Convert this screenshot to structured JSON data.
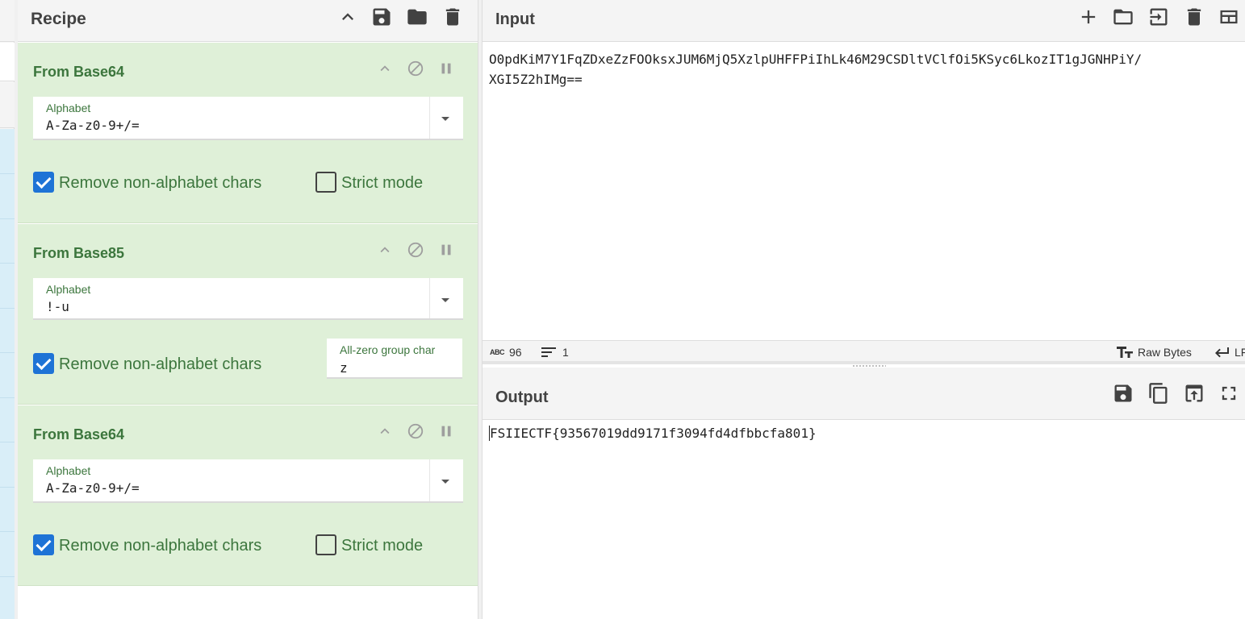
{
  "recipe": {
    "title": "Recipe",
    "operations": [
      {
        "name": "From Base64",
        "alphabet_label": "Alphabet",
        "alphabet_value": "A-Za-z0-9+/=",
        "remove_label": "Remove non-alphabet chars",
        "remove_checked": true,
        "strict_label": "Strict mode",
        "strict_checked": false
      },
      {
        "name": "From Base85",
        "alphabet_label": "Alphabet",
        "alphabet_value": "!-u",
        "remove_label": "Remove non-alphabet chars",
        "remove_checked": true,
        "zero_label": "All-zero group char",
        "zero_value": "z"
      },
      {
        "name": "From Base64",
        "alphabet_label": "Alphabet",
        "alphabet_value": "A-Za-z0-9+/=",
        "remove_label": "Remove non-alphabet chars",
        "remove_checked": true,
        "strict_label": "Strict mode",
        "strict_checked": false
      }
    ]
  },
  "input": {
    "title": "Input",
    "text": "O0pdKiM7Y1FqZDxeZzFOOksxJUM6MjQ5XzlpUHFFPiIhLk46M29CSDltVClfOi5KSyc6LkozIT1gJGNHPiY/XGI5Z2hIMg==",
    "line1": "O0pdKiM7Y1FqZDxeZzFOOksxJUM6MjQ5XzlpUHFFPiIhLk46M29CSDltVClfOi5KSyc6LkozIT1gJGNHPiY/",
    "line2": "XGI5Z2hIMg=="
  },
  "status": {
    "abc_label": "ABC",
    "length": "96",
    "lines": "1",
    "encoding": "Raw Bytes",
    "eol": "LF"
  },
  "output": {
    "title": "Output",
    "text": "FSIIECTF{93567019dd9171f3094fd4dfbbcfa801}"
  },
  "icons": {
    "recipe": [
      "chevron-up-icon",
      "save-icon",
      "folder-icon",
      "trash-icon"
    ],
    "input": [
      "plus-icon",
      "folder-icon",
      "import-icon",
      "trash-icon",
      "layout-icon"
    ],
    "output": [
      "save-icon",
      "copy-icon",
      "upload-icon",
      "fullscreen-icon"
    ],
    "operation": [
      "chevron-up-icon",
      "disable-icon",
      "pause-icon"
    ]
  },
  "colors": {
    "accent_green": "#3c763d",
    "op_background": "#dff0d8",
    "checkbox_blue": "#1e73d6"
  }
}
